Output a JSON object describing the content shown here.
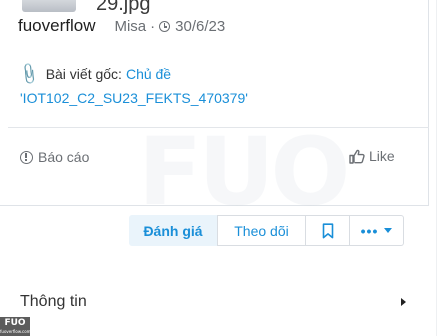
{
  "post": {
    "filename": "29.jpg",
    "author": "fuoverflow",
    "author_role": "Misa",
    "separator": "·",
    "date": "30/6/23",
    "original_label": "Bài viết gốc:",
    "original_link": "Chủ đề",
    "topic": "'IOT102_C2_SU23_FEKTS_470379'"
  },
  "footer": {
    "report_label": "Báo cáo",
    "like_label": "Like"
  },
  "actions": {
    "rate_label": "Đánh giá",
    "follow_label": "Theo dõi",
    "bookmark_icon": "bookmark-icon",
    "more_label": "•••"
  },
  "info": {
    "label": "Thông tin"
  },
  "watermark": {
    "big": "FUO",
    "small": "FUOVERFLOW.COM"
  },
  "corner": {
    "brand": "FUO",
    "tiny": "fuoverflow.com"
  },
  "colors": {
    "accent": "#1a8fd8",
    "rate_bg": "#eaf4fb",
    "muted": "#6b6f74",
    "border": "#d9dde2"
  }
}
